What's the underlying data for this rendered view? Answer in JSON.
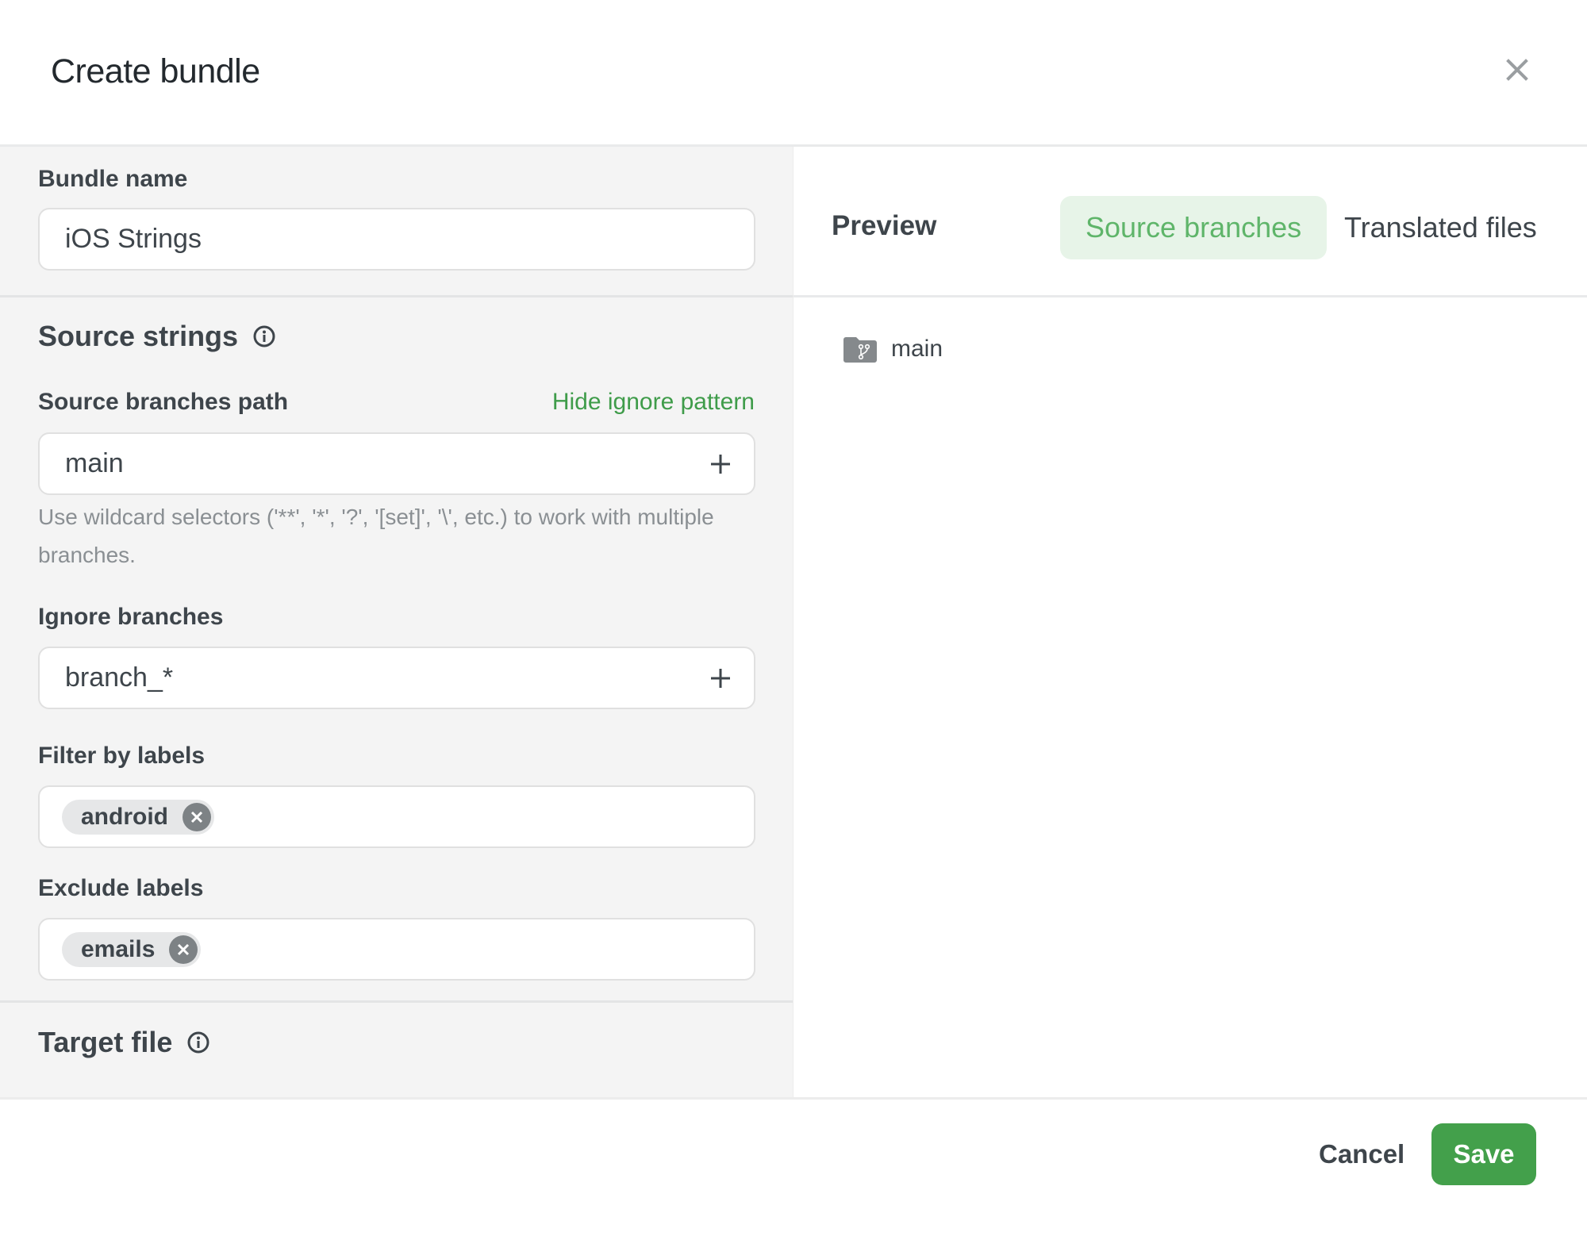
{
  "dialog": {
    "title": "Create bundle",
    "close_icon": "close-icon"
  },
  "form": {
    "bundle_name": {
      "label": "Bundle name",
      "value": "iOS Strings"
    },
    "source_strings": {
      "title": "Source strings",
      "info_icon": "info-icon",
      "source_branches_path": {
        "label": "Source branches path",
        "toggle_link": "Hide ignore pattern",
        "value": "main",
        "helper": "Use wildcard selectors ('**', '*', '?', '[set]', '\\', etc.) to work with multiple branches."
      },
      "ignore_branches": {
        "label": "Ignore branches",
        "value": "branch_*"
      },
      "filter_by_labels": {
        "label": "Filter by labels",
        "chips": [
          "android"
        ]
      },
      "exclude_labels": {
        "label": "Exclude labels",
        "chips": [
          "emails"
        ]
      }
    },
    "target_file": {
      "title": "Target file",
      "info_icon": "info-icon"
    }
  },
  "preview": {
    "label": "Preview",
    "tabs": [
      {
        "label": "Source branches",
        "active": true
      },
      {
        "label": "Translated files",
        "active": false
      }
    ],
    "branches": [
      {
        "name": "main",
        "icon": "branch-folder-icon"
      }
    ]
  },
  "footer": {
    "cancel_label": "Cancel",
    "save_label": "Save"
  },
  "colors": {
    "accent": "#43a04b",
    "link": "#3f9c4a",
    "active_tab_bg": "#e7f4e8",
    "active_tab_text": "#5fb56a",
    "panel_bg": "#f4f4f4"
  }
}
